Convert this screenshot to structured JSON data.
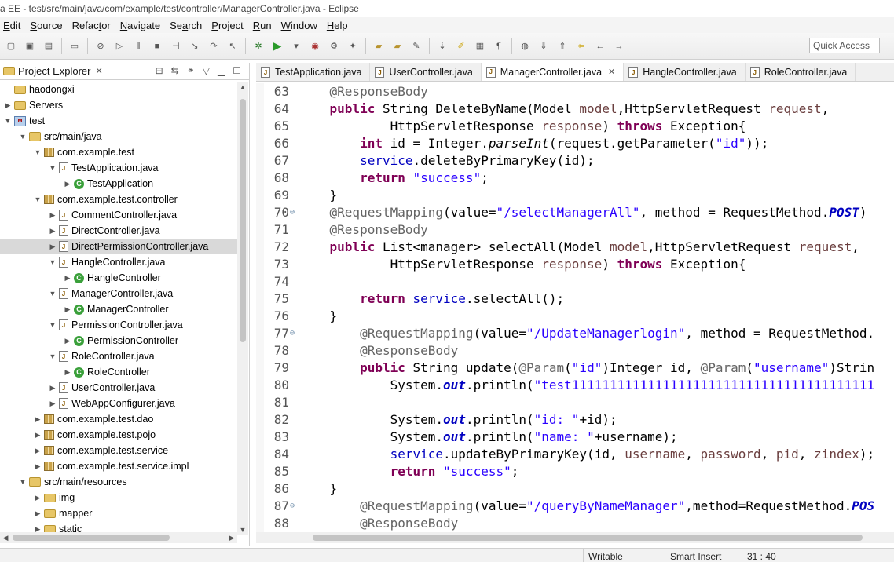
{
  "window": {
    "title": "a EE - test/src/main/java/com/example/test/controller/ManagerController.java - Eclipse"
  },
  "menu": [
    {
      "label": "Edit",
      "accel": "E"
    },
    {
      "label": "Source",
      "accel": "S"
    },
    {
      "label": "Refactor",
      "accel": "t"
    },
    {
      "label": "Navigate",
      "accel": "N"
    },
    {
      "label": "Search",
      "accel": "a"
    },
    {
      "label": "Project",
      "accel": "P"
    },
    {
      "label": "Run",
      "accel": "R"
    },
    {
      "label": "Window",
      "accel": "W"
    },
    {
      "label": "Help",
      "accel": "H"
    }
  ],
  "toolbar": {
    "quick_access": "Quick Access"
  },
  "explorer": {
    "title": "Project Explorer",
    "tree": [
      {
        "label": "haodongxi",
        "indent": 0,
        "twisty": "",
        "icon": "folder"
      },
      {
        "label": "Servers",
        "indent": 0,
        "twisty": ">",
        "icon": "folder"
      },
      {
        "label": "test",
        "indent": 0,
        "twisty": "v",
        "icon": "mvn"
      },
      {
        "label": "src/main/java",
        "indent": 1,
        "twisty": "v",
        "icon": "srcf"
      },
      {
        "label": "com.example.test",
        "indent": 2,
        "twisty": "v",
        "icon": "pkg"
      },
      {
        "label": "TestApplication.java",
        "indent": 3,
        "twisty": "v",
        "icon": "java"
      },
      {
        "label": "TestApplication",
        "indent": 4,
        "twisty": ">",
        "icon": "cls"
      },
      {
        "label": "com.example.test.controller",
        "indent": 2,
        "twisty": "v",
        "icon": "pkg"
      },
      {
        "label": "CommentController.java",
        "indent": 3,
        "twisty": ">",
        "icon": "java"
      },
      {
        "label": "DirectController.java",
        "indent": 3,
        "twisty": ">",
        "icon": "java"
      },
      {
        "label": "DirectPermissionController.java",
        "indent": 3,
        "twisty": ">",
        "icon": "java",
        "selected": true
      },
      {
        "label": "HangleController.java",
        "indent": 3,
        "twisty": "v",
        "icon": "java"
      },
      {
        "label": "HangleController",
        "indent": 4,
        "twisty": ">",
        "icon": "cls"
      },
      {
        "label": "ManagerController.java",
        "indent": 3,
        "twisty": "v",
        "icon": "java"
      },
      {
        "label": "ManagerController",
        "indent": 4,
        "twisty": ">",
        "icon": "cls"
      },
      {
        "label": "PermissionController.java",
        "indent": 3,
        "twisty": "v",
        "icon": "java"
      },
      {
        "label": "PermissionController",
        "indent": 4,
        "twisty": ">",
        "icon": "cls"
      },
      {
        "label": "RoleController.java",
        "indent": 3,
        "twisty": "v",
        "icon": "java"
      },
      {
        "label": "RoleController",
        "indent": 4,
        "twisty": ">",
        "icon": "cls"
      },
      {
        "label": "UserController.java",
        "indent": 3,
        "twisty": ">",
        "icon": "java"
      },
      {
        "label": "WebAppConfigurer.java",
        "indent": 3,
        "twisty": ">",
        "icon": "java"
      },
      {
        "label": "com.example.test.dao",
        "indent": 2,
        "twisty": ">",
        "icon": "pkg"
      },
      {
        "label": "com.example.test.pojo",
        "indent": 2,
        "twisty": ">",
        "icon": "pkg"
      },
      {
        "label": "com.example.test.service",
        "indent": 2,
        "twisty": ">",
        "icon": "pkg"
      },
      {
        "label": "com.example.test.service.impl",
        "indent": 2,
        "twisty": ">",
        "icon": "pkg"
      },
      {
        "label": "src/main/resources",
        "indent": 1,
        "twisty": "v",
        "icon": "srcf"
      },
      {
        "label": "img",
        "indent": 2,
        "twisty": ">",
        "icon": "folder"
      },
      {
        "label": "mapper",
        "indent": 2,
        "twisty": ">",
        "icon": "folder"
      },
      {
        "label": "static",
        "indent": 2,
        "twisty": ">",
        "icon": "folder"
      }
    ]
  },
  "editor": {
    "tabs": [
      {
        "label": "TestApplication.java",
        "active": false
      },
      {
        "label": "UserController.java",
        "active": false
      },
      {
        "label": "ManagerController.java",
        "active": true
      },
      {
        "label": "HangleController.java",
        "active": false
      },
      {
        "label": "RoleController.java",
        "active": false
      }
    ],
    "lines": [
      {
        "n": "63",
        "fold": "",
        "segs": [
          [
            "    ",
            ""
          ],
          [
            "@ResponseBody",
            "an"
          ]
        ]
      },
      {
        "n": "64",
        "fold": "",
        "segs": [
          [
            "    ",
            ""
          ],
          [
            "public",
            "kw"
          ],
          [
            " String DeleteByName(Model ",
            ""
          ],
          [
            "model",
            "mv"
          ],
          [
            ",HttpServletRequest ",
            ""
          ],
          [
            "request",
            "mv"
          ],
          [
            ",",
            ""
          ]
        ]
      },
      {
        "n": "65",
        "fold": "",
        "segs": [
          [
            "            HttpServletResponse ",
            ""
          ],
          [
            "response",
            "mv"
          ],
          [
            ") ",
            ""
          ],
          [
            "throws",
            "kw"
          ],
          [
            " Exception{",
            ""
          ]
        ]
      },
      {
        "n": "66",
        "fold": "",
        "segs": [
          [
            "        ",
            ""
          ],
          [
            "int",
            "kw"
          ],
          [
            " id = Integer.",
            ""
          ],
          [
            "parseInt",
            "it"
          ],
          [
            "(request.getParameter(",
            ""
          ],
          [
            "\"id\"",
            "st"
          ],
          [
            "));",
            ""
          ]
        ]
      },
      {
        "n": "67",
        "fold": "",
        "segs": [
          [
            "        ",
            ""
          ],
          [
            "service",
            "fd2"
          ],
          [
            ".deleteByPrimaryKey(id);",
            ""
          ]
        ]
      },
      {
        "n": "68",
        "fold": "",
        "segs": [
          [
            "        ",
            ""
          ],
          [
            "return",
            "kw"
          ],
          [
            " ",
            ""
          ],
          [
            "\"success\"",
            "st"
          ],
          [
            ";",
            ""
          ]
        ]
      },
      {
        "n": "69",
        "fold": "",
        "segs": [
          [
            "    }",
            ""
          ]
        ]
      },
      {
        "n": "70",
        "fold": "⊖",
        "segs": [
          [
            "    ",
            ""
          ],
          [
            "@RequestMapping",
            "an"
          ],
          [
            "(value=",
            ""
          ],
          [
            "\"/selectManagerAll\"",
            "st"
          ],
          [
            ", method = RequestMethod.",
            ""
          ],
          [
            "POST",
            "fd"
          ],
          [
            ")",
            ""
          ]
        ]
      },
      {
        "n": "71",
        "fold": "",
        "segs": [
          [
            "    ",
            ""
          ],
          [
            "@ResponseBody",
            "an"
          ]
        ]
      },
      {
        "n": "72",
        "fold": "",
        "segs": [
          [
            "    ",
            ""
          ],
          [
            "public",
            "kw"
          ],
          [
            " List<manager> selectAll(Model ",
            ""
          ],
          [
            "model",
            "mv"
          ],
          [
            ",HttpServletRequest ",
            ""
          ],
          [
            "request",
            "mv"
          ],
          [
            ",",
            ""
          ]
        ]
      },
      {
        "n": "73",
        "fold": "",
        "segs": [
          [
            "            HttpServletResponse ",
            ""
          ],
          [
            "response",
            "mv"
          ],
          [
            ") ",
            ""
          ],
          [
            "throws",
            "kw"
          ],
          [
            " Exception{",
            ""
          ]
        ]
      },
      {
        "n": "74",
        "fold": "",
        "segs": [
          [
            "",
            ""
          ]
        ]
      },
      {
        "n": "75",
        "fold": "",
        "segs": [
          [
            "        ",
            ""
          ],
          [
            "return",
            "kw"
          ],
          [
            " ",
            ""
          ],
          [
            "service",
            "fd2"
          ],
          [
            ".selectAll();",
            ""
          ]
        ]
      },
      {
        "n": "76",
        "fold": "",
        "segs": [
          [
            "    }",
            ""
          ]
        ]
      },
      {
        "n": "77",
        "fold": "⊖",
        "segs": [
          [
            "        ",
            ""
          ],
          [
            "@RequestMapping",
            "an"
          ],
          [
            "(value=",
            ""
          ],
          [
            "\"/UpdateManagerlogin\"",
            "st"
          ],
          [
            ", method = RequestMethod.",
            ""
          ]
        ]
      },
      {
        "n": "78",
        "fold": "",
        "segs": [
          [
            "        ",
            ""
          ],
          [
            "@ResponseBody",
            "an"
          ]
        ]
      },
      {
        "n": "79",
        "fold": "",
        "segs": [
          [
            "        ",
            ""
          ],
          [
            "public",
            "kw"
          ],
          [
            " String update(",
            ""
          ],
          [
            "@Param",
            "an"
          ],
          [
            "(",
            ""
          ],
          [
            "\"id\"",
            "st"
          ],
          [
            ")Integer id, ",
            ""
          ],
          [
            "@Param",
            "an"
          ],
          [
            "(",
            ""
          ],
          [
            "\"username\"",
            "st"
          ],
          [
            ")Strin",
            ""
          ]
        ]
      },
      {
        "n": "80",
        "fold": "",
        "segs": [
          [
            "            System.",
            ""
          ],
          [
            "out",
            "fd"
          ],
          [
            ".println(",
            ""
          ],
          [
            "\"test1111111111111111111111111111111111111111",
            "st"
          ]
        ]
      },
      {
        "n": "81",
        "fold": "",
        "segs": [
          [
            "",
            ""
          ]
        ]
      },
      {
        "n": "82",
        "fold": "",
        "segs": [
          [
            "            System.",
            ""
          ],
          [
            "out",
            "fd"
          ],
          [
            ".println(",
            ""
          ],
          [
            "\"id: \"",
            "st"
          ],
          [
            "+id);",
            ""
          ]
        ]
      },
      {
        "n": "83",
        "fold": "",
        "segs": [
          [
            "            System.",
            ""
          ],
          [
            "out",
            "fd"
          ],
          [
            ".println(",
            ""
          ],
          [
            "\"name: \"",
            "st"
          ],
          [
            "+username);",
            ""
          ]
        ]
      },
      {
        "n": "84",
        "fold": "",
        "segs": [
          [
            "            ",
            ""
          ],
          [
            "service",
            "fd2"
          ],
          [
            ".updateByPrimaryKey(id, ",
            ""
          ],
          [
            "username",
            "mv"
          ],
          [
            ", ",
            ""
          ],
          [
            "password",
            "mv"
          ],
          [
            ", ",
            ""
          ],
          [
            "pid",
            "mv"
          ],
          [
            ", ",
            ""
          ],
          [
            "zindex",
            "mv"
          ],
          [
            ");",
            ""
          ]
        ]
      },
      {
        "n": "85",
        "fold": "",
        "segs": [
          [
            "            ",
            ""
          ],
          [
            "return",
            "kw"
          ],
          [
            " ",
            ""
          ],
          [
            "\"success\"",
            "st"
          ],
          [
            ";",
            ""
          ]
        ]
      },
      {
        "n": "86",
        "fold": "",
        "segs": [
          [
            "    }",
            ""
          ]
        ]
      },
      {
        "n": "87",
        "fold": "⊖",
        "segs": [
          [
            "        ",
            ""
          ],
          [
            "@RequestMapping",
            "an"
          ],
          [
            "(value=",
            ""
          ],
          [
            "\"/queryByNameManager\"",
            "st"
          ],
          [
            ",method=RequestMethod.",
            ""
          ],
          [
            "POS",
            "fd"
          ]
        ]
      },
      {
        "n": "88",
        "fold": "",
        "segs": [
          [
            "        ",
            ""
          ],
          [
            "@ResponseBody",
            "an"
          ]
        ]
      }
    ]
  },
  "status": {
    "writable": "Writable",
    "insert_mode": "Smart Insert",
    "position": "31 : 40"
  }
}
